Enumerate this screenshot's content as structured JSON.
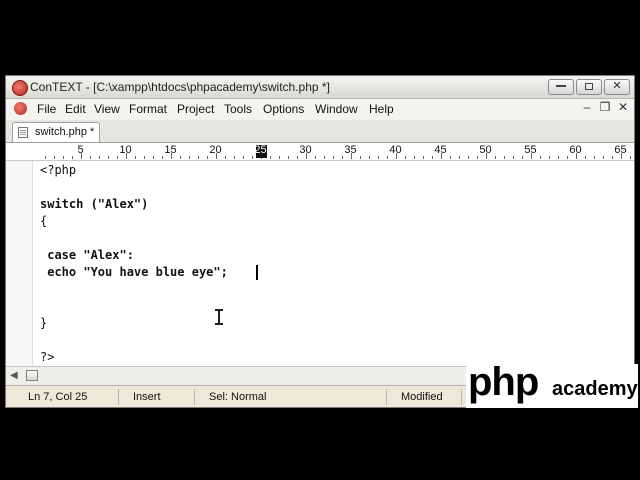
{
  "window": {
    "title": "ConTEXT - [C:\\xampp\\htdocs\\phpacademy\\switch.php *]",
    "controls": {
      "minimize": "minimize",
      "maximize": "maximize",
      "close": "✕"
    }
  },
  "menubar": {
    "items": [
      "File",
      "Edit",
      "View",
      "Format",
      "Project",
      "Tools",
      "Options",
      "Window",
      "Help"
    ],
    "mdi_controls": {
      "minimize": "–",
      "restore": "❐",
      "close": "✕"
    }
  },
  "tabs": [
    {
      "label": "switch.php *",
      "active": true
    }
  ],
  "ruler": {
    "labels": [
      "5",
      "10",
      "15",
      "20",
      "25",
      "30",
      "35",
      "40",
      "45",
      "50",
      "55",
      "60",
      "65"
    ],
    "cursor_column": 25
  },
  "editor": {
    "lines": [
      "<?php",
      "",
      "switch (\"Alex\")",
      "{",
      "",
      " case \"Alex\":",
      " echo \"You have blue eye\";",
      "",
      "",
      "}",
      "",
      "?>"
    ]
  },
  "statusbar": {
    "position": "Ln 7, Col 25",
    "mode": "Insert",
    "syntax": "Sel: Normal",
    "state": "Modified"
  },
  "logo": {
    "brand": "php",
    "sub": "academy"
  },
  "colors": {
    "accent_red": "#c0392b",
    "window_bg": "#ece9d8",
    "editor_bg": "#ffffff"
  }
}
